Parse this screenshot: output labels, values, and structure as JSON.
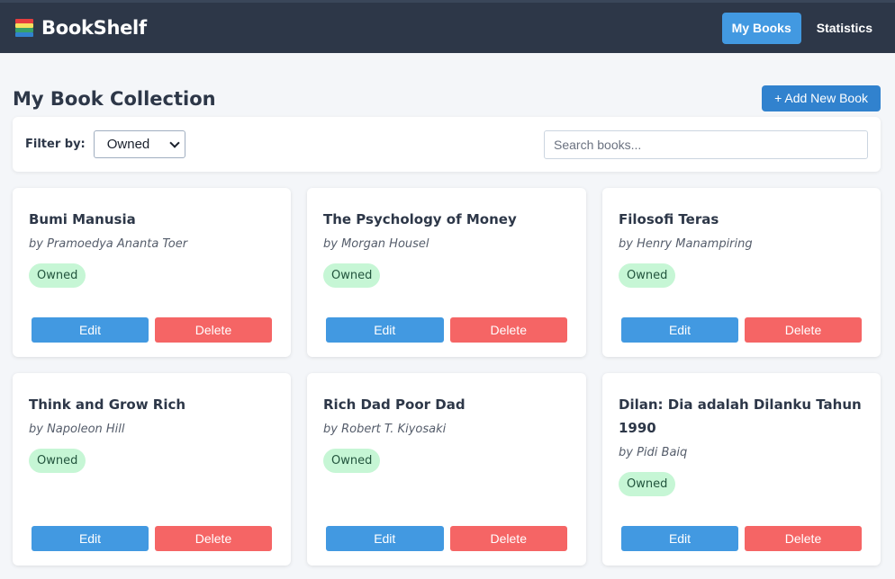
{
  "app": {
    "title": "BookShelf",
    "logo_icon": "books-stack-icon"
  },
  "nav": {
    "items": [
      {
        "label": "My Books",
        "active": true
      },
      {
        "label": "Statistics",
        "active": false
      }
    ]
  },
  "page": {
    "title": "My Book Collection",
    "add_button_label": "+ Add New Book"
  },
  "filter": {
    "label": "Filter by:",
    "selected": "Owned",
    "search_placeholder": "Search books..."
  },
  "colors": {
    "navbar": "#2d3748",
    "accent": "#4299e1",
    "danger": "#f56565",
    "badge_bg": "#c6f6d5",
    "badge_text": "#22543d"
  },
  "card_actions": {
    "edit_label": "Edit",
    "delete_label": "Delete"
  },
  "books": [
    {
      "title": "Bumi Manusia",
      "author": "by Pramoedya Ananta Toer",
      "status": "Owned"
    },
    {
      "title": "The Psychology of Money",
      "author": "by Morgan Housel",
      "status": "Owned"
    },
    {
      "title": "Filosofi Teras",
      "author": "by Henry Manampiring",
      "status": "Owned"
    },
    {
      "title": "Think and Grow Rich",
      "author": "by Napoleon Hill",
      "status": "Owned"
    },
    {
      "title": "Rich Dad Poor Dad",
      "author": "by Robert T. Kiyosaki",
      "status": "Owned"
    },
    {
      "title": "Dilan: Dia adalah Dilanku Tahun 1990",
      "author": "by Pidi Baiq",
      "status": "Owned"
    }
  ]
}
